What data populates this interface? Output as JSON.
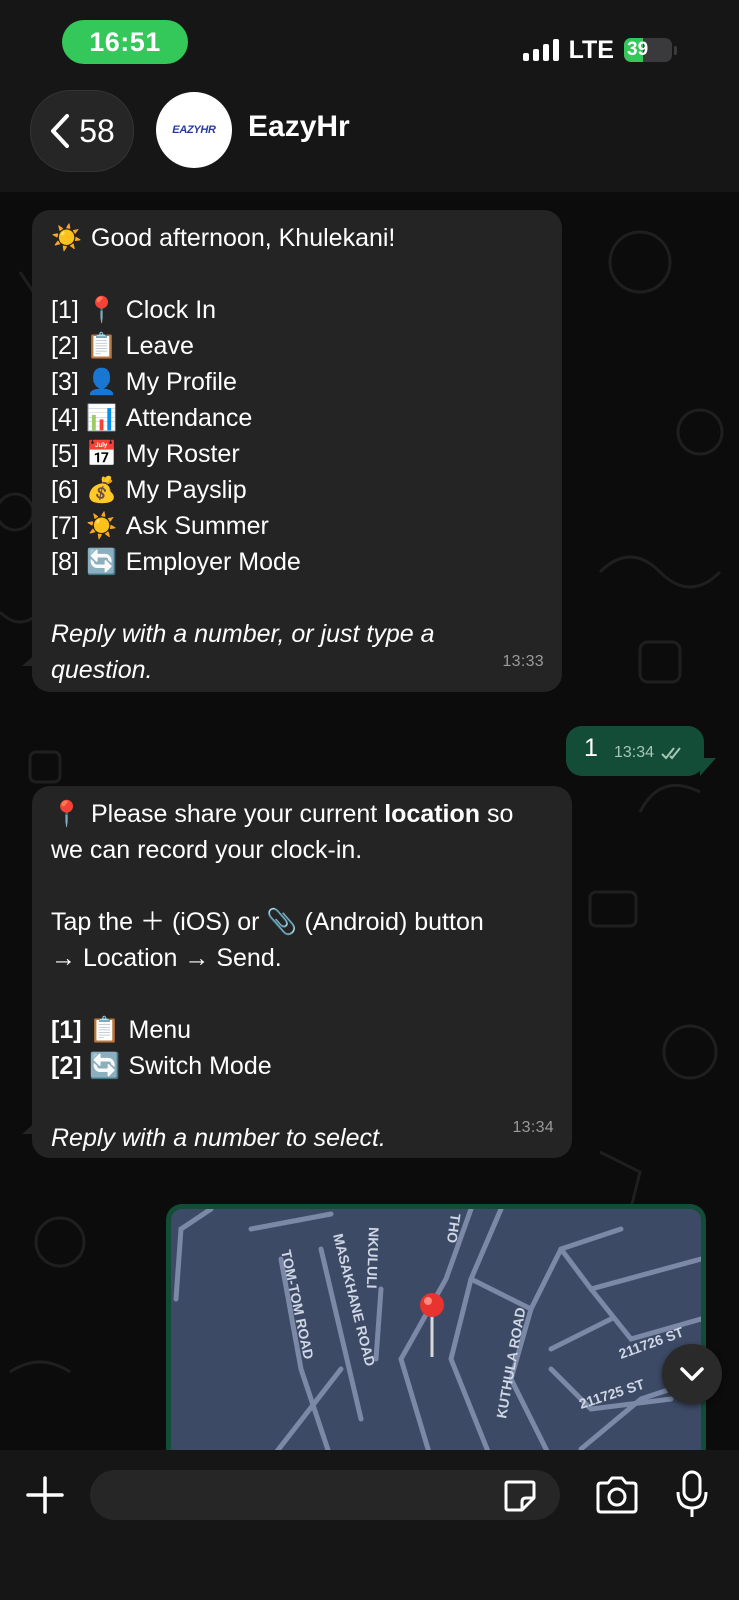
{
  "status_bar": {
    "time": "16:51",
    "network": "LTE",
    "battery": "39",
    "battery_level": 0.39,
    "colors": {
      "time_pill": "#34c759",
      "battery_fill": "#34c759"
    }
  },
  "header": {
    "back_count": "58",
    "contact_name": "EazyHr",
    "avatar_text": "EAZYHR",
    "icons": {
      "back": "chevron-left-icon"
    }
  },
  "messages": {
    "m1": {
      "greeting": "Good afternoon, Khulekani!",
      "greeting_emoji": "☀️",
      "items": [
        {
          "number": "[1]",
          "emoji": "📍",
          "label": "Clock In"
        },
        {
          "number": "[2]",
          "emoji": "📋",
          "label": "Leave"
        },
        {
          "number": "[3]",
          "emoji": "👤",
          "label": "My Profile"
        },
        {
          "number": "[4]",
          "emoji": "📊",
          "label": "Attendance"
        },
        {
          "number": "[5]",
          "emoji": "📅",
          "label": "My Roster"
        },
        {
          "number": "[6]",
          "emoji": "💰",
          "label": "My Payslip"
        },
        {
          "number": "[7]",
          "emoji": "☀️",
          "label": "Ask Summer"
        },
        {
          "number": "[8]",
          "emoji": "🔄",
          "label": "Employer Mode"
        }
      ],
      "footer_line1": "Reply with a number, or just type a",
      "footer_line2": "question.",
      "time": "13:33"
    },
    "m2": {
      "text": "1",
      "time": "13:34",
      "status_icon": "double-check-icon"
    },
    "m3": {
      "emoji": "📍",
      "line1_pre": "Please share your current ",
      "line1_bold": "location",
      "line1_post": " so",
      "line2": "we can record your clock-in.",
      "line3_pre": "Tap the",
      "plus_glyph": "＋",
      "line3_mid": "(iOS) or",
      "clip_emoji": "📎",
      "line3_post": "(Android) button",
      "line4": "→ Location → Send.",
      "items": [
        {
          "number": "[1]",
          "emoji": "📋",
          "label": "Menu"
        },
        {
          "number": "[2]",
          "emoji": "🔄",
          "label": "Switch Mode"
        }
      ],
      "footer": "Reply with a number to select.",
      "time": "13:34"
    },
    "map": {
      "roads": [
        "TOM-TOM ROAD",
        "MASAKHANE ROAD",
        "NKULULI",
        "THO",
        "KUTHULA ROAD",
        "211726 ST",
        "211725 ST"
      ],
      "colors": {
        "bg": "#3c4a66",
        "road": "#7b88a6",
        "pin": "#e8332e"
      }
    }
  },
  "input_bar": {
    "placeholder": "",
    "icons": [
      "plus-icon",
      "sticker-icon",
      "camera-icon",
      "microphone-icon"
    ]
  },
  "colors": {
    "incoming_bubble": "#242424",
    "outgoing_bubble": "#134d37",
    "background": "#0c0c0c",
    "header": "#161616"
  }
}
